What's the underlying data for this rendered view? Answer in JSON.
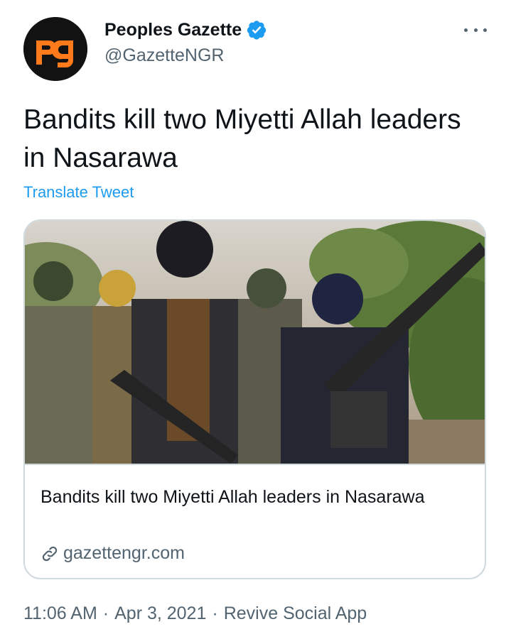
{
  "tweet": {
    "author": {
      "avatar_text": "pg",
      "display_name": "Peoples Gazette",
      "verified": true,
      "handle": "@GazetteNGR"
    },
    "more_icon": "more-horizontal-icon",
    "text": "Bandits kill two Miyetti Allah leaders in Nasarawa",
    "translate_label": "Translate Tweet",
    "card": {
      "title": "Bandits kill two Miyetti Allah leaders in Nasarawa",
      "domain": "gazettengr.com",
      "link_icon": "link-icon"
    },
    "meta": {
      "time": "11:06 AM",
      "separator": "·",
      "date": "Apr 3, 2021",
      "source": "Revive Social App"
    }
  },
  "colors": {
    "text_primary": "#0f1419",
    "text_secondary": "#536471",
    "link_blue": "#1d9bf0",
    "border": "#cfd9de",
    "avatar_bg": "#121212",
    "avatar_brand": "#ff7a1a"
  }
}
